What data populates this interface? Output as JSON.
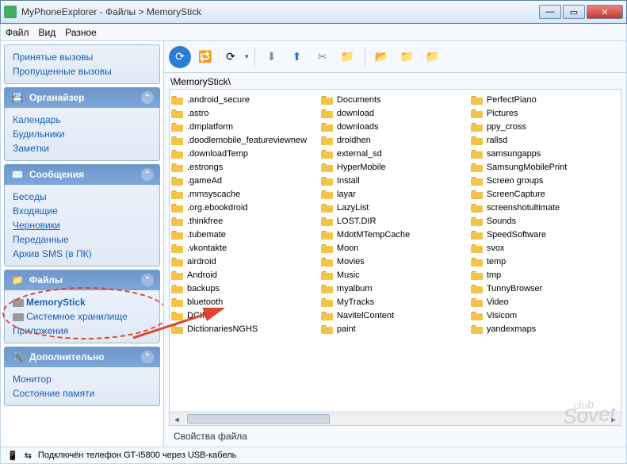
{
  "window": {
    "title": "MyPhoneExplorer -  Файлы > MemoryStick"
  },
  "menu": {
    "file": "Файл",
    "view": "Вид",
    "misc": "Разное"
  },
  "sidebar": {
    "calls": {
      "received": "Принятые вызовы",
      "missed": "Пропущенные вызовы"
    },
    "org": {
      "title": "Органайзер",
      "calendar": "Календарь",
      "alarms": "Будильники",
      "notes": "Заметки"
    },
    "msg": {
      "title": "Сообщения",
      "convos": "Беседы",
      "inbox": "Входящие",
      "drafts": "Черновики",
      "sent": "Переданные",
      "archive": "Архив SMS (в ПК)"
    },
    "files": {
      "title": "Файлы",
      "memstick": "MemoryStick",
      "sysstore": "Системное хранилище",
      "apps": "Приложения"
    },
    "extra": {
      "title": "Дополнительно",
      "monitor": "Монитор",
      "memstate": "Состояние памяти"
    }
  },
  "content": {
    "breadcrumb": "\\MemoryStick\\",
    "props": "Свойства файла",
    "columns": [
      [
        ".android_secure",
        ".astro",
        ".dmplatform",
        ".doodlemobile_featureviewnew",
        ".downloadTemp",
        ".estrongs",
        ".gameAd",
        ".mmsyscache",
        ".org.ebookdroid",
        ".thinkfree",
        ".tubemate",
        ".vkontakte",
        "airdroid",
        "Android",
        "backups",
        "bluetooth",
        "DCIM",
        "DictionariesNGHS"
      ],
      [
        "Documents",
        "download",
        "downloads",
        "droidhen",
        "external_sd",
        "HyperMobile",
        "Install",
        "layar",
        "LazyList",
        "LOST.DIR",
        "MdotMTempCache",
        "Moon",
        "Movies",
        "Music",
        "myalbum",
        "MyTracks",
        "NavitelContent",
        "paint"
      ],
      [
        "PerfectPiano",
        "Pictures",
        "ppy_cross",
        "rallsd",
        "samsungapps",
        "SamsungMobilePrint",
        "Screen groups",
        "ScreenCapture",
        "screenshotultimate",
        "Sounds",
        "SpeedSoftware",
        "svox",
        "temp",
        "tmp",
        "TunnyBrowser",
        "Video",
        "Visicom",
        "yandexmaps"
      ]
    ]
  },
  "status": {
    "text": "Подключён телефон GT-I5800 через USB-кабель"
  },
  "watermark": {
    "small": "club",
    "big": "Sovet"
  }
}
